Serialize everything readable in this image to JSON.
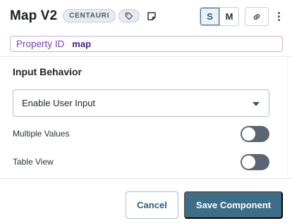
{
  "header": {
    "title": "Map V2",
    "badge": "CENTAURI",
    "tag_icon": "tag-icon",
    "note_icon": "note-icon",
    "size_options": [
      "S",
      "M"
    ],
    "size_selected": "S",
    "link_icon": "link-icon",
    "more_icon": "kebab-menu-icon"
  },
  "property": {
    "label": "Property ID",
    "value": "map"
  },
  "input_behavior": {
    "title": "Input Behavior",
    "select_value": "Enable User Input",
    "toggles": [
      {
        "label": "Multiple Values",
        "enabled": false
      },
      {
        "label": "Table View",
        "enabled": false
      }
    ]
  },
  "footer": {
    "cancel_label": "Cancel",
    "save_label": "Save Component"
  },
  "colors": {
    "accent": "#3c6e87",
    "property_accent": "#7a3fb5",
    "toggle_off": "#5c6672"
  }
}
